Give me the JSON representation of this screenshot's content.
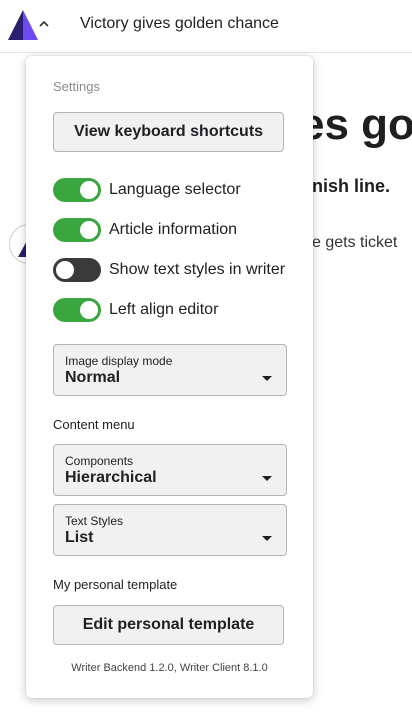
{
  "header": {
    "title": "Victory gives golden chance",
    "logo_icon": "writer-logo-icon",
    "menu_icon": "chevron-up-icon"
  },
  "article": {
    "headline_fragment": "es go",
    "subheading_fragment": "nish line.",
    "body_fragment": "e gets ticket"
  },
  "settings": {
    "heading": "Settings",
    "keyboard_shortcuts_label": "View keyboard shortcuts",
    "toggles": [
      {
        "label": "Language selector",
        "on": true
      },
      {
        "label": "Article information",
        "on": true
      },
      {
        "label": "Show text styles in writer",
        "on": false
      },
      {
        "label": "Left align editor",
        "on": true
      }
    ],
    "image_display_mode": {
      "label": "Image display mode",
      "value": "Normal"
    },
    "content_menu_label": "Content menu",
    "components": {
      "label": "Components",
      "value": "Hierarchical"
    },
    "text_styles": {
      "label": "Text Styles",
      "value": "List"
    },
    "personal_template_label": "My personal template",
    "edit_template_label": "Edit personal template",
    "version": "Writer Backend 1.2.0, Writer Client 8.1.0"
  },
  "colors": {
    "toggle_on": "#3aa63f",
    "toggle_off": "#3a3a3a",
    "logo_purple": "#5b3fd6"
  }
}
